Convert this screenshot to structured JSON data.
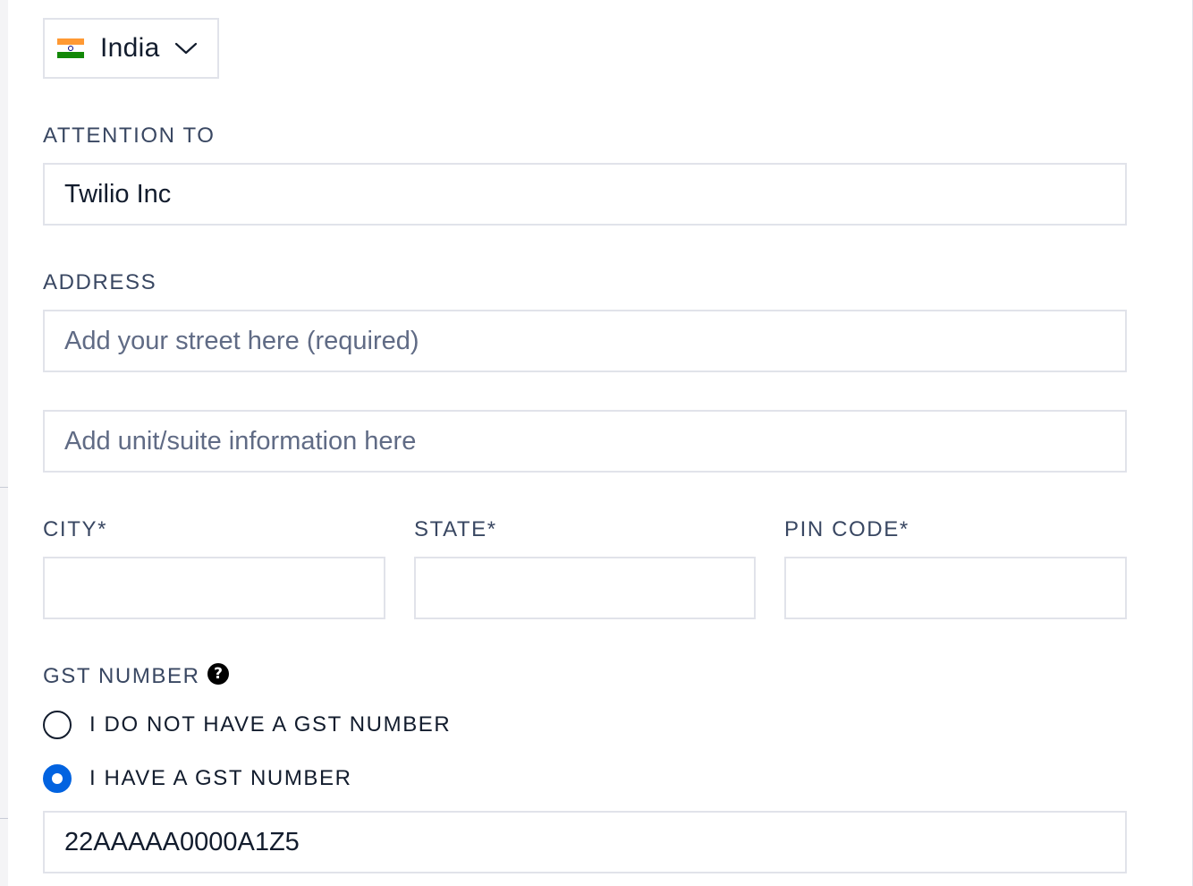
{
  "country": {
    "selected": "India",
    "flag_icon": "india-flag-icon",
    "chevron_icon": "chevron-down-icon"
  },
  "attention": {
    "label": "ATTENTION TO",
    "value": "Twilio Inc",
    "placeholder": ""
  },
  "address": {
    "label": "ADDRESS",
    "street_placeholder": "Add your street here (required)",
    "street_value": "",
    "unit_placeholder": "Add unit/suite information here",
    "unit_value": ""
  },
  "city": {
    "label": "CITY*",
    "value": ""
  },
  "state": {
    "label": "STATE*",
    "value": ""
  },
  "pin_code": {
    "label": "PIN CODE*",
    "value": ""
  },
  "gst": {
    "label": "GST NUMBER",
    "help_icon": "question-circle-icon",
    "help_glyph": "?",
    "options": [
      {
        "label": "I DO NOT HAVE A GST NUMBER",
        "checked": false
      },
      {
        "label": "I HAVE A GST NUMBER",
        "checked": true
      }
    ],
    "value": "22AAAAA0000A1Z5"
  },
  "colors": {
    "accent": "#0263e0",
    "border": "#e1e3ea",
    "text": "#121c2d",
    "label": "#394762",
    "placeholder": "#606b85"
  }
}
